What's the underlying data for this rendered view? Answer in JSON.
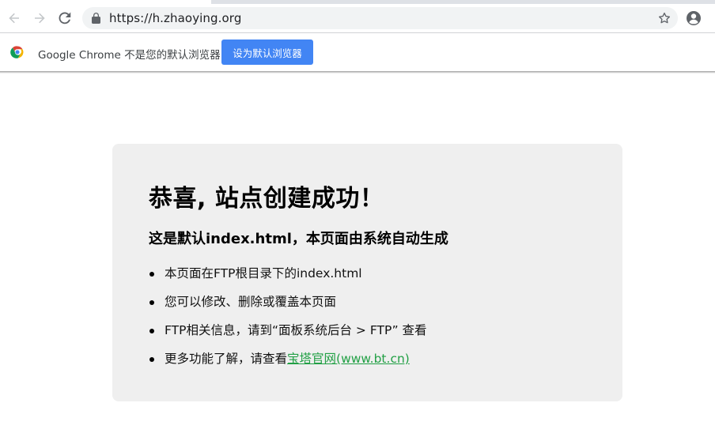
{
  "browser": {
    "url": "https://h.zhaoying.org",
    "back_icon": "arrow-left-icon",
    "forward_icon": "arrow-right-icon",
    "reload_icon": "reload-icon",
    "lock_icon": "lock-icon",
    "bookmark_icon": "star-icon",
    "profile_icon": "account-circle-icon"
  },
  "infobar": {
    "message": "Google Chrome 不是您的默认浏览器",
    "button_label": "设为默认浏览器",
    "button_color": "#4285f4"
  },
  "page": {
    "title": "恭喜, 站点创建成功！",
    "subtitle": "这是默认index.html，本页面由系统自动生成",
    "items": [
      {
        "text": "本页面在FTP根目录下的index.html"
      },
      {
        "text": "您可以修改、删除或覆盖本页面"
      },
      {
        "text": "FTP相关信息，请到“面板系统后台 > FTP” 查看"
      },
      {
        "text": "更多功能了解，请查看",
        "link": "宝塔官网(www.bt.cn)"
      }
    ],
    "link_color": "#22a045",
    "card_color": "#efefef"
  }
}
